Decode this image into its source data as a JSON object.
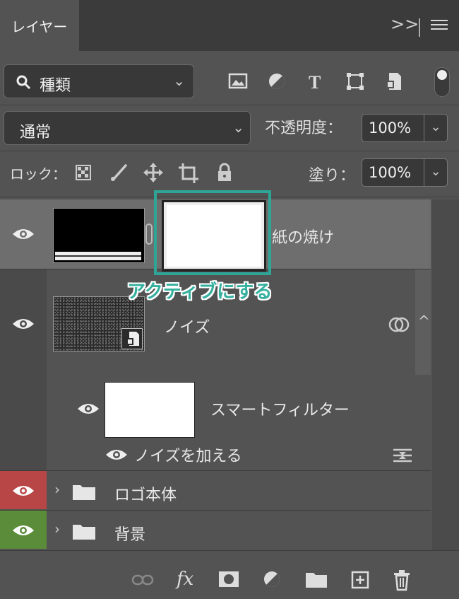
{
  "tab": {
    "label": "レイヤー"
  },
  "header": {
    "expand_icon": "double-chevron-right-icon",
    "menu_icon": "hamburger-menu-icon"
  },
  "filter": {
    "kind_label": "種類",
    "icons": [
      "image-filter-icon",
      "adjustment-filter-icon",
      "type-filter-icon",
      "shape-filter-icon",
      "smart-object-filter-icon"
    ]
  },
  "blend": {
    "mode": "通常"
  },
  "opacity": {
    "label": "不透明度：",
    "value": "100%"
  },
  "lock": {
    "label": "ロック：",
    "icons": [
      "lock-transparent-pixels-icon",
      "lock-image-pixels-icon",
      "lock-position-icon",
      "lock-artboard-icon",
      "lock-all-icon"
    ]
  },
  "fill": {
    "label": "塗り：",
    "value": "100%"
  },
  "layers": [
    {
      "name": "紙の焼け",
      "visible": true,
      "selected": true
    },
    {
      "name": "ノイズ",
      "visible": true
    },
    {
      "name": "スマートフィルター",
      "visible": true
    },
    {
      "name": "ノイズを加える",
      "visible": true
    },
    {
      "name": "ロゴ本体",
      "visible": true,
      "eye_color": "#b84646"
    },
    {
      "name": "背景",
      "visible": true,
      "eye_color": "#5a8c3a"
    }
  ],
  "annotation": {
    "text": "アクティブにする",
    "color": "#2ea597"
  },
  "footer": {
    "icons": [
      "link-layers-icon",
      "fx-icon",
      "add-mask-icon",
      "new-adjustment-layer-icon",
      "new-group-icon",
      "new-layer-icon",
      "delete-layer-icon"
    ],
    "fx_label": "fx"
  }
}
